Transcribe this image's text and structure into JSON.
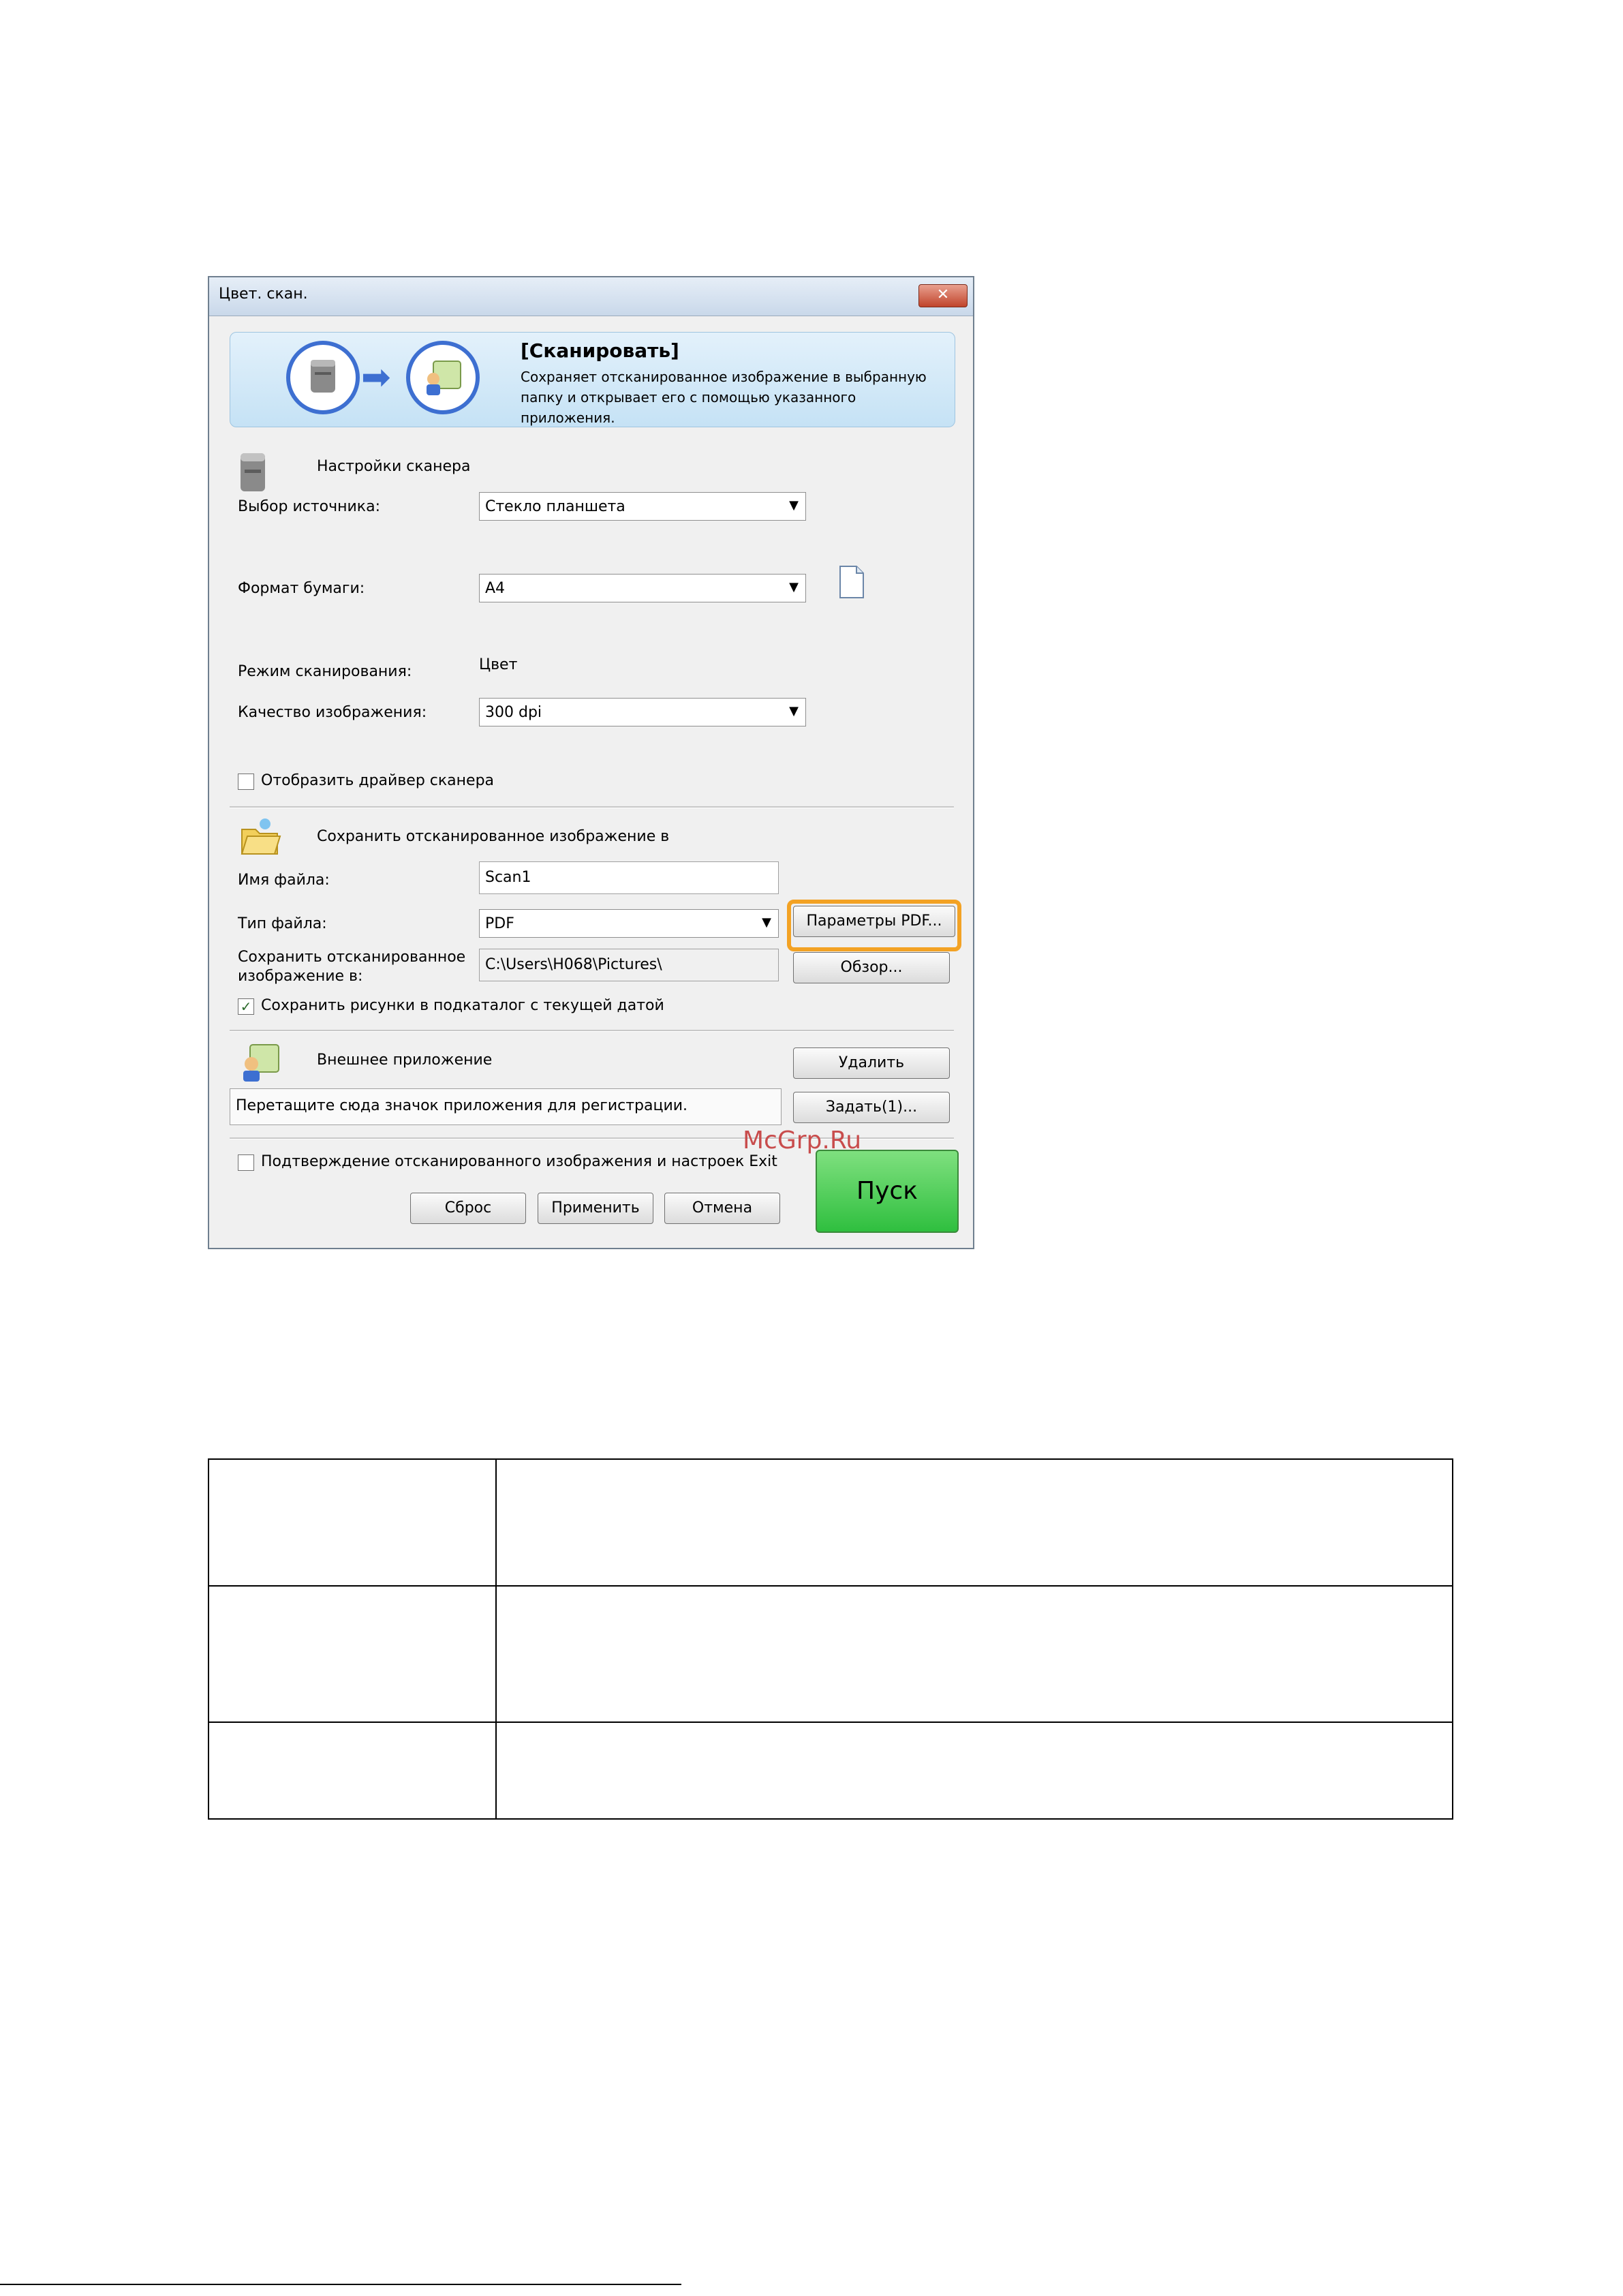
{
  "dialog": {
    "title": "Цвет. скан.",
    "close_glyph": "✕",
    "banner": {
      "title": "[Сканировать]",
      "description": "Сохраняет отсканированное изображение в выбранную папку и открывает его с помощью указанного приложения.",
      "arrow_glyph": "➡"
    },
    "scanner_settings": {
      "section_label": "Настройки сканера",
      "source_label": "Выбор источника:",
      "source_value": "Стекло планшета",
      "paper_label": "Формат бумаги:",
      "paper_value": "A4",
      "mode_label": "Режим сканирования:",
      "mode_value": "Цвет",
      "quality_label": "Качество изображения:",
      "quality_value": "300 dpi",
      "show_driver_label": "Отобразить драйвер сканера",
      "show_driver_checked": false
    },
    "save_settings": {
      "section_label": "Сохранить отсканированное изображение в",
      "filename_label": "Имя файла:",
      "filename_value": "Scan1",
      "filetype_label": "Тип файла:",
      "filetype_value": "PDF",
      "pdf_params_button": "Параметры PDF...",
      "save_to_label": "Сохранить отсканированное изображение в:",
      "save_to_value": "C:\\Users\\H068\\Pictures\\",
      "browse_button": "Обзор...",
      "subfolder_label": "Сохранить рисунки в подкаталог с текущей датой",
      "subfolder_checked": true,
      "check_glyph": "✓"
    },
    "external_app": {
      "section_label": "Внешнее приложение",
      "delete_button": "Удалить",
      "drop_hint": "Перетащите сюда значок приложения для регистрации.",
      "set_button": "Задать(1)..."
    },
    "confirm_label": "Подтверждение отсканированного изображения и настроек Exit",
    "confirm_checked": false,
    "buttons": {
      "reset": "Сброс",
      "apply": "Применить",
      "cancel": "Отмена",
      "start": "Пуск"
    },
    "colors": {
      "highlight": "#f3a224",
      "start_button": "#2fbf3f",
      "banner_accent": "#3d6fd1"
    }
  },
  "watermark": "McGrp.Ru",
  "table": {
    "rows": [
      [
        "",
        ""
      ],
      [
        "",
        ""
      ],
      [
        "",
        ""
      ]
    ]
  }
}
